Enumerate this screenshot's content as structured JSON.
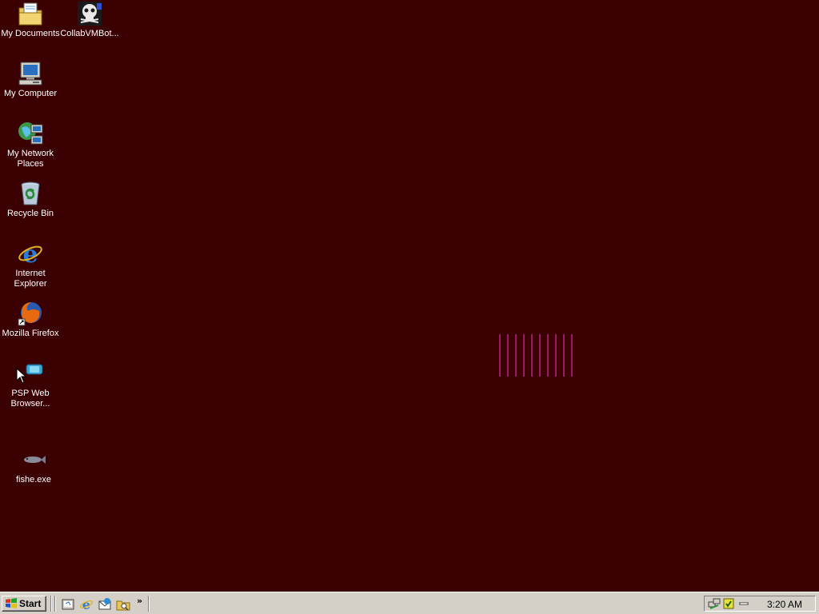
{
  "desktop": {
    "background": "#3a0002",
    "icons": [
      {
        "label": "My Documents",
        "icon": "my-documents-icon"
      },
      {
        "label": "CollabVMBot...",
        "icon": "collabvmbot-icon"
      },
      {
        "label": "My Computer",
        "icon": "my-computer-icon"
      },
      {
        "label": "My Network\nPlaces",
        "icon": "network-places-icon"
      },
      {
        "label": "Recycle Bin",
        "icon": "recycle-bin-icon"
      },
      {
        "label": "Internet\nExplorer",
        "icon": "internet-explorer-icon"
      },
      {
        "label": "Mozilla Firefox",
        "icon": "firefox-icon"
      },
      {
        "label": "PSP Web\nBrowser...",
        "icon": "psp-web-browser-icon"
      },
      {
        "label": "fishe.exe",
        "icon": "fish-icon"
      }
    ],
    "stripe_color": "#c0208a"
  },
  "taskbar": {
    "start_label": "Start",
    "quick_launch": [
      "show-desktop-icon",
      "internet-explorer-icon",
      "outlook-express-icon",
      "windows-explorer-icon"
    ],
    "overflow_label": "»",
    "tray_icons": [
      "network-icon",
      "security-icon",
      "volume-icon"
    ],
    "clock": "3:20 AM"
  }
}
